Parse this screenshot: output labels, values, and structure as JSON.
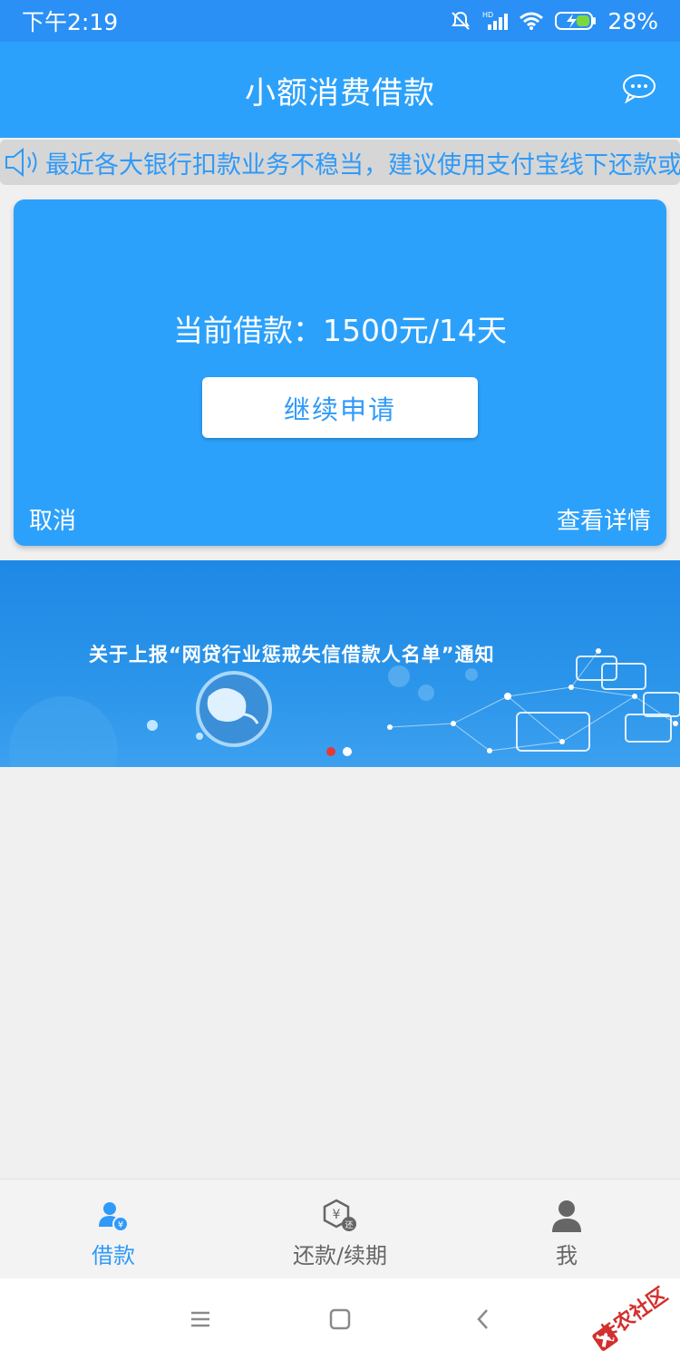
{
  "status_bar": {
    "time": "下午2:19",
    "battery": "28%"
  },
  "header": {
    "title": "小额消费借款",
    "chat_icon": "chat-bubble-icon"
  },
  "notice": {
    "icon": "speaker-icon",
    "text": "最近各大银行扣款业务不稳当，建议使用支付宝线下还款或"
  },
  "loan_card": {
    "current_loan": "当前借款：1500元/14天",
    "continue_button": "继续申请",
    "cancel_link": "取消",
    "detail_link": "查看详情"
  },
  "banner": {
    "title": "关于上报“网贷行业惩戒失信借款人名单”通知",
    "active_dot_color": "#e53935",
    "inactive_dot_color": "#ffffff"
  },
  "tabs": [
    {
      "label": "借款",
      "icon": "user-yuan-icon",
      "active": true
    },
    {
      "label": "还款/续期",
      "icon": "yuan-return-icon",
      "active": false
    },
    {
      "label": "我",
      "icon": "person-icon",
      "active": false
    }
  ],
  "colors": {
    "primary": "#2ca1fb",
    "status_bar": "#2a90f5",
    "active_tab": "#2f9af8",
    "inactive_tab": "#666666"
  },
  "watermark": {
    "text": "卡农社区"
  }
}
